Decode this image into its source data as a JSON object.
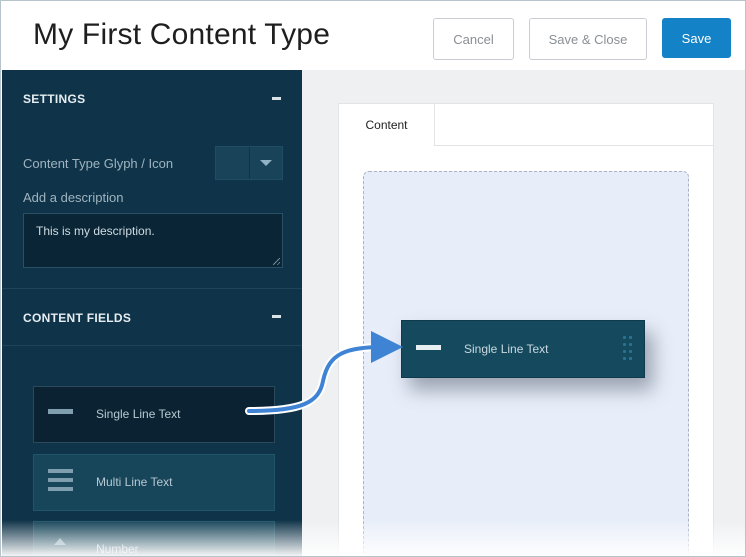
{
  "header": {
    "title": "My First Content Type",
    "cancel_label": "Cancel",
    "save_close_label": "Save & Close",
    "save_label": "Save"
  },
  "sidebar": {
    "settings": {
      "heading": "SETTINGS",
      "glyph_label": "Content Type Glyph / Icon",
      "description_label": "Add a description",
      "description_value": "This is my description."
    },
    "content_fields": {
      "heading": "CONTENT FIELDS",
      "items": [
        {
          "label": "Single Line Text",
          "icon": "single-line-icon",
          "active": true
        },
        {
          "label": "Multi Line Text",
          "icon": "multi-line-icon",
          "active": false
        },
        {
          "label": "Number",
          "icon": "number-icon",
          "active": false
        }
      ]
    }
  },
  "main": {
    "tabs": [
      {
        "label": "Content"
      }
    ],
    "dragged_field": {
      "label": "Single Line Text",
      "icon": "single-line-icon"
    }
  },
  "colors": {
    "accent": "#1482c6",
    "sidebar_bg": "#0f3348",
    "arrow": "#3f84d4"
  }
}
